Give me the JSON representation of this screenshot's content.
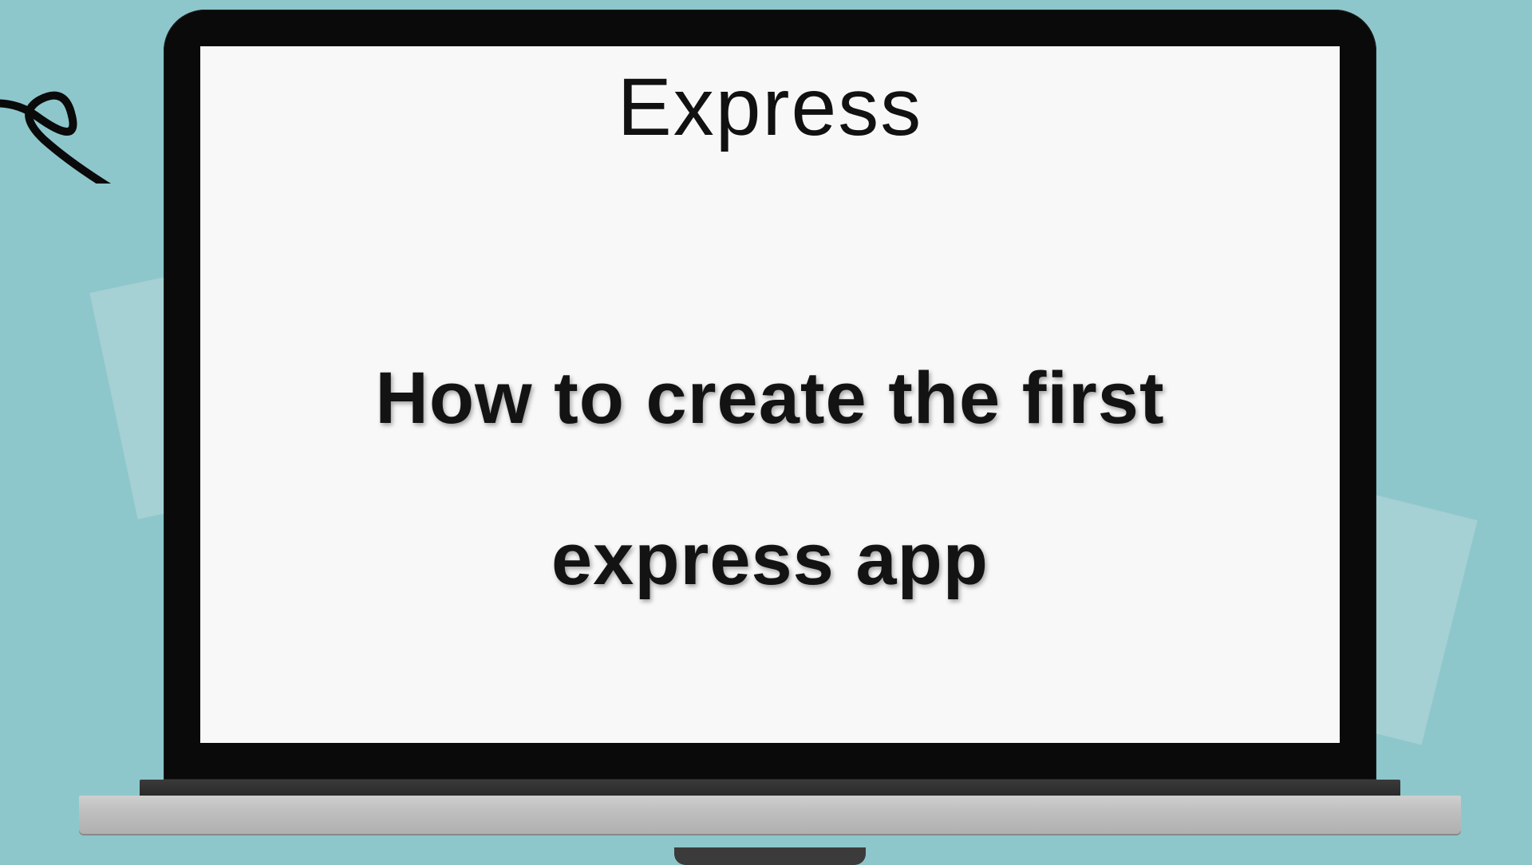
{
  "screen": {
    "logo_text": "Express",
    "headline": "How to create the first express app"
  },
  "colors": {
    "background": "#8dc7cc",
    "paper": "#a5d0d4",
    "bezel": "#0a0a0a",
    "screen": "#f8f8f8",
    "text": "#131313"
  }
}
